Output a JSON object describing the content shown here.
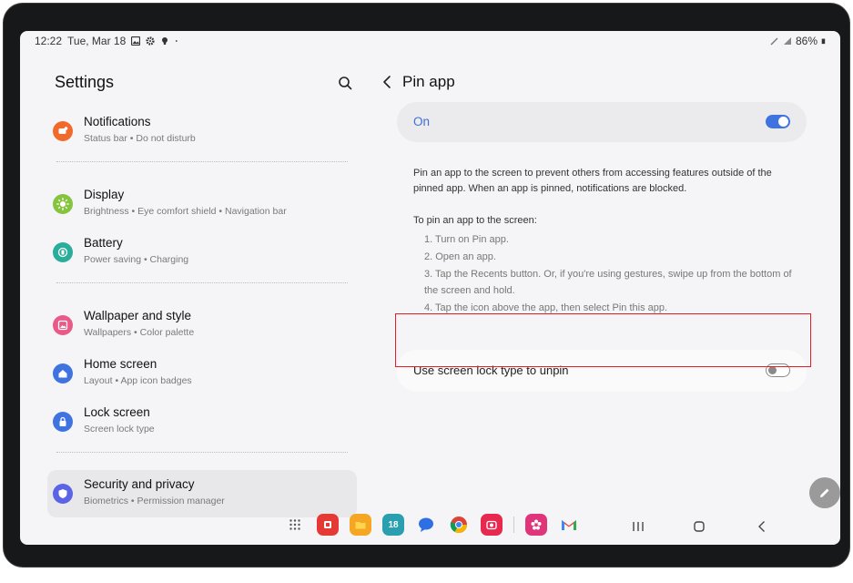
{
  "status_bar": {
    "time": "12:22",
    "date": "Tue, Mar 18",
    "battery": "86%",
    "icons": [
      "gallery-icon",
      "gear-icon",
      "lightbulb-icon",
      "dot-icon",
      "pen-icon",
      "wifi-icon",
      "battery-icon"
    ]
  },
  "settings": {
    "title": "Settings",
    "items": [
      {
        "title": "Notifications",
        "subtitle": "Status bar  •  Do not disturb",
        "icon": "bell-icon",
        "color": "#f26a2b"
      },
      {
        "title": "Display",
        "subtitle": "Brightness  •  Eye comfort shield  •  Navigation bar",
        "icon": "sun-icon",
        "color": "#86c43f"
      },
      {
        "title": "Battery",
        "subtitle": "Power saving  •  Charging",
        "icon": "battery-icon",
        "color": "#2aad9a"
      },
      {
        "title": "Wallpaper and style",
        "subtitle": "Wallpapers  •  Color palette",
        "icon": "image-icon",
        "color": "#e85a87"
      },
      {
        "title": "Home screen",
        "subtitle": "Layout  •  App icon badges",
        "icon": "home-icon",
        "color": "#3f74e0"
      },
      {
        "title": "Lock screen",
        "subtitle": "Screen lock type",
        "icon": "lock-icon",
        "color": "#3f74e0"
      },
      {
        "title": "Security and privacy",
        "subtitle": "Biometrics  •  Permission manager",
        "icon": "shield-icon",
        "color": "#5b63e6",
        "selected": true
      }
    ]
  },
  "pin_app": {
    "title": "Pin app",
    "master_label": "On",
    "master_on": true,
    "description": "Pin an app to the screen to prevent others from accessing features outside of the pinned app. When an app is pinned, notifications are blocked.",
    "steps_title": "To pin an app to the screen:",
    "steps": [
      "1. Turn on Pin app.",
      "2. Open an app.",
      "3. Tap the Recents button. Or, if you're using gestures, swipe up from the bottom of the screen and hold.",
      "4. Tap the icon above the app, then select Pin this app."
    ],
    "lock_option_label": "Use screen lock type to unpin",
    "lock_option_on": false
  },
  "dock": {
    "apps": [
      "apps-grid-icon",
      "flipboard-icon",
      "files-icon",
      "calendar-icon",
      "messages-icon",
      "chrome-icon",
      "camera-icon",
      "bixby-icon",
      "gmail-icon"
    ],
    "calendar_day": "18"
  },
  "colors": {
    "accent": "#3f74e0",
    "highlight": "#e31e24"
  }
}
